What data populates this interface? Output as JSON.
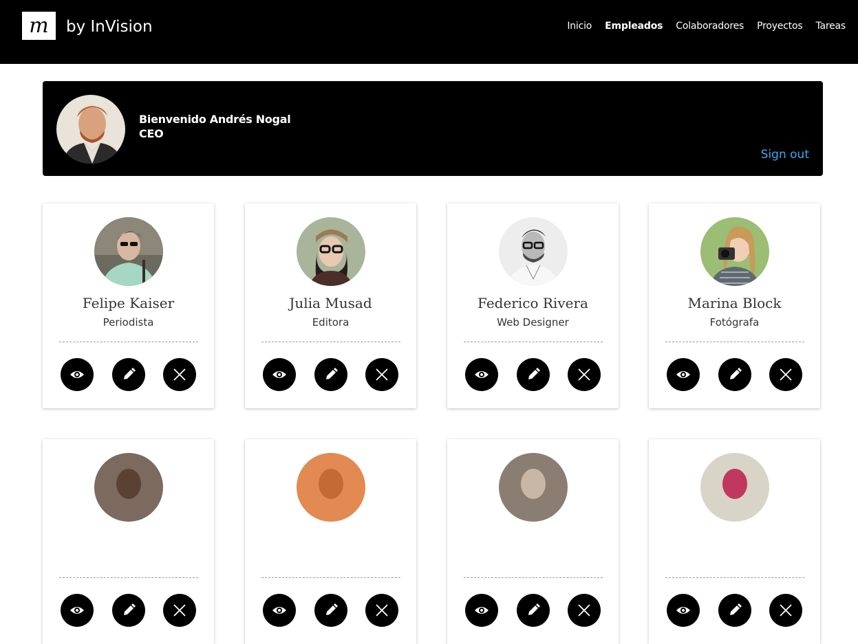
{
  "brand": {
    "logo_letter": "m",
    "name": "by InVision"
  },
  "nav": {
    "items": [
      {
        "label": "Inicio",
        "active": false
      },
      {
        "label": "Empleados",
        "active": true
      },
      {
        "label": "Colaboradores",
        "active": false
      },
      {
        "label": "Proyectos",
        "active": false
      },
      {
        "label": "Tareas",
        "active": false
      }
    ]
  },
  "welcome": {
    "greeting": "Bienvenido Andrés Nogal",
    "role": "CEO",
    "signout": "Sign out",
    "signout_color": "#3fa9f5"
  },
  "employees": [
    {
      "name": "Felipe Kaiser",
      "role": "Periodista"
    },
    {
      "name": "Julia Musad",
      "role": "Editora"
    },
    {
      "name": "Federico Rivera",
      "role": "Web Designer"
    },
    {
      "name": "Marina Block",
      "role": "Fotógrafa"
    },
    {
      "name": "",
      "role": ""
    },
    {
      "name": "",
      "role": ""
    },
    {
      "name": "",
      "role": ""
    },
    {
      "name": "",
      "role": ""
    }
  ],
  "icons": {
    "view": "eye-icon",
    "edit": "pencil-icon",
    "delete": "close-icon"
  }
}
